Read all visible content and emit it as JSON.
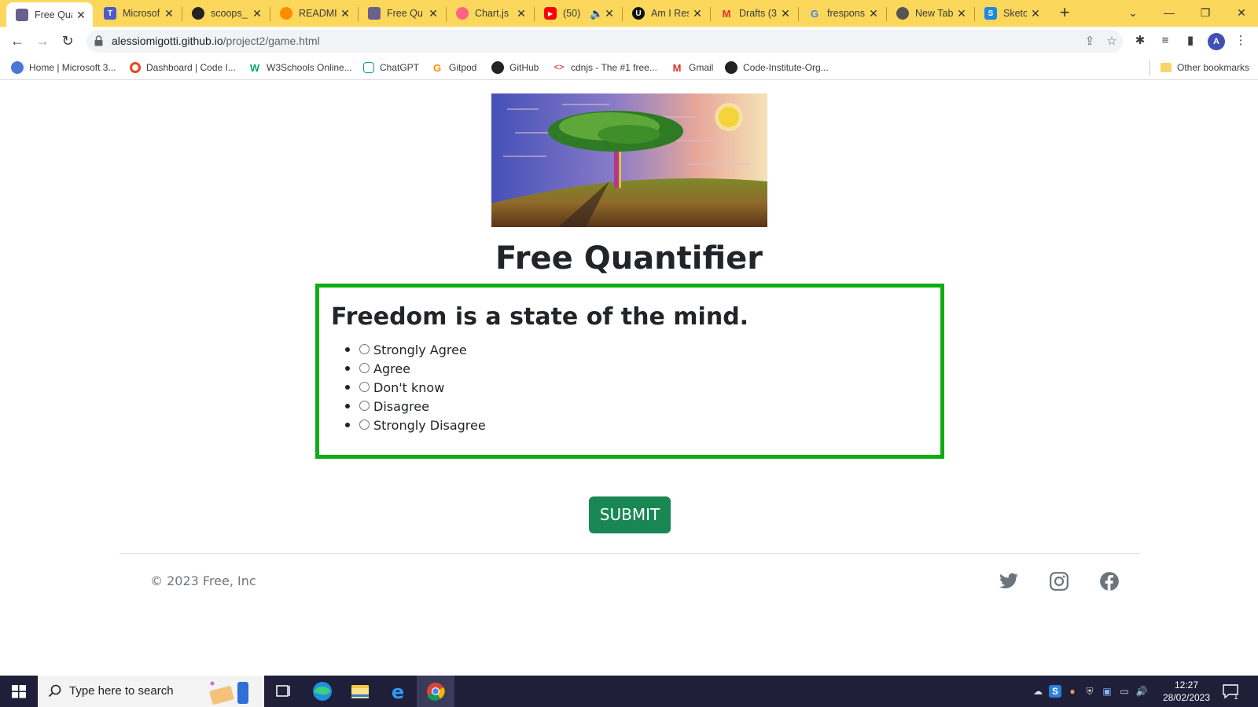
{
  "browser": {
    "tabs": [
      {
        "title": "Free Qua",
        "favicon": "image-icon",
        "active": true
      },
      {
        "title": "Microsof",
        "favicon": "teams-icon"
      },
      {
        "title": "scoops_",
        "favicon": "github-icon"
      },
      {
        "title": "READMI",
        "favicon": "gitpod-icon"
      },
      {
        "title": "Free Qu",
        "favicon": "image-icon"
      },
      {
        "title": "Chart.js",
        "favicon": "chartjs-icon"
      },
      {
        "title": "(50)",
        "favicon": "youtube-icon"
      },
      {
        "title": "Am I Res",
        "favicon": "ami-icon"
      },
      {
        "title": "Drafts (3",
        "favicon": "gmail-icon"
      },
      {
        "title": "frespons",
        "favicon": "google-icon"
      },
      {
        "title": "New Tab",
        "favicon": "chrome-icon"
      },
      {
        "title": "Sketchb",
        "favicon": "sketchbook-icon"
      }
    ],
    "url_host": "alessiomigotti.github.io",
    "url_path": "/project2/game.html",
    "profile_initial": "A",
    "bookmarks": [
      {
        "label": "Home | Microsoft 3..."
      },
      {
        "label": "Dashboard | Code I..."
      },
      {
        "label": "W3Schools Online..."
      },
      {
        "label": "ChatGPT"
      },
      {
        "label": "Gitpod"
      },
      {
        "label": "GitHub"
      },
      {
        "label": "cdnjs - The #1 free..."
      },
      {
        "label": "Gmail"
      },
      {
        "label": "Code-Institute-Org..."
      }
    ],
    "other_bookmarks": "Other bookmarks"
  },
  "page": {
    "title": "Free Quantifier",
    "question": "Freedom is a state of the mind.",
    "answers": [
      "Strongly Agree",
      "Agree",
      "Don't know",
      "Disagree",
      "Strongly Disagree"
    ],
    "submit_label": "SUBMIT",
    "copyright": "© 2023 Free, Inc",
    "social": [
      "twitter-icon",
      "instagram-icon",
      "facebook-icon"
    ],
    "colors": {
      "box_border": "#0dad13",
      "submit_bg": "#198754"
    }
  },
  "taskbar": {
    "search_placeholder": "Type here to search",
    "time": "12:27",
    "date": "28/02/2023",
    "notification_count": "1"
  }
}
